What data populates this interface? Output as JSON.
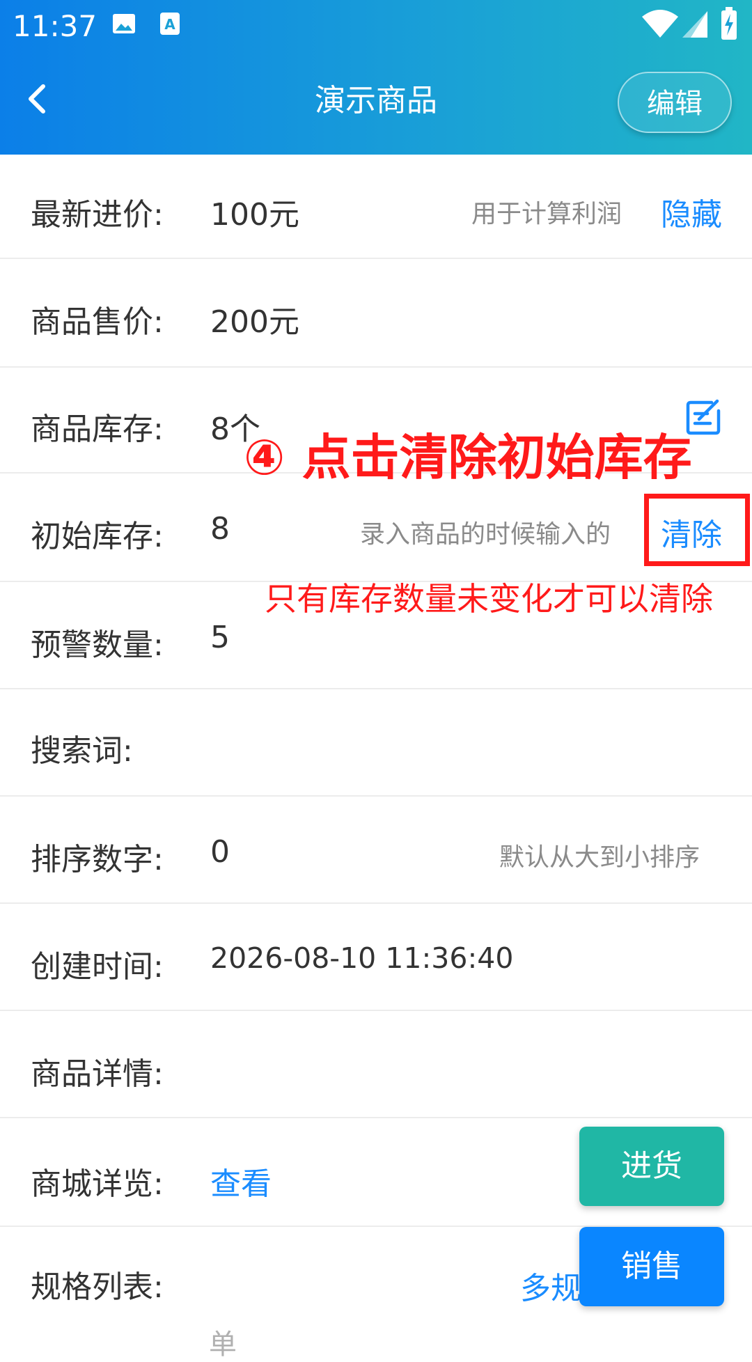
{
  "status_bar": {
    "time": "11:37"
  },
  "header": {
    "title": "演示商品",
    "edit_label": "编辑"
  },
  "rows": {
    "latest_cost": {
      "label": "最新进价:",
      "value": "100元",
      "hint": "用于计算利润",
      "action": "隐藏"
    },
    "price": {
      "label": "商品售价:",
      "value": "200元"
    },
    "stock": {
      "label": "商品库存:",
      "value": "8个"
    },
    "initial_stock": {
      "label": "初始库存:",
      "value": "8",
      "hint": "录入商品的时候输入的",
      "action": "清除"
    },
    "warning_qty": {
      "label": "预警数量:",
      "value": "5"
    },
    "keywords": {
      "label": "搜索词:",
      "value": ""
    },
    "sort_number": {
      "label": "排序数字:",
      "value": "0",
      "hint": "默认从大到小排序"
    },
    "created_time": {
      "label": "创建时间:",
      "value": "2026-08-10 11:36:40"
    },
    "detail": {
      "label": "商品详情:",
      "value": ""
    },
    "mall_preview": {
      "label": "商城详览:",
      "action": "查看"
    },
    "spec_list": {
      "label": "规格列表:",
      "action": "多规"
    }
  },
  "annotation": {
    "title": "④ 点击清除初始库存",
    "note": "只有库存数量未变化才可以清除"
  },
  "fab": {
    "purchase": "进货",
    "sale": "销售"
  },
  "bottom_text": "单",
  "colors": {
    "accent": "#1a8cff",
    "header_start": "#0b7fe8",
    "header_end": "#21b6c6",
    "annotation": "#ff1a1a",
    "purchase": "#20b7a5",
    "sale": "#0a86ff"
  },
  "icons": {
    "back": "chevron-left-icon",
    "edit_stock": "edit-square-icon",
    "gallery": "image-icon",
    "keyboard": "a-notification-icon",
    "wifi": "wifi-icon",
    "signal": "signal-icon",
    "battery": "battery-charging-icon"
  }
}
